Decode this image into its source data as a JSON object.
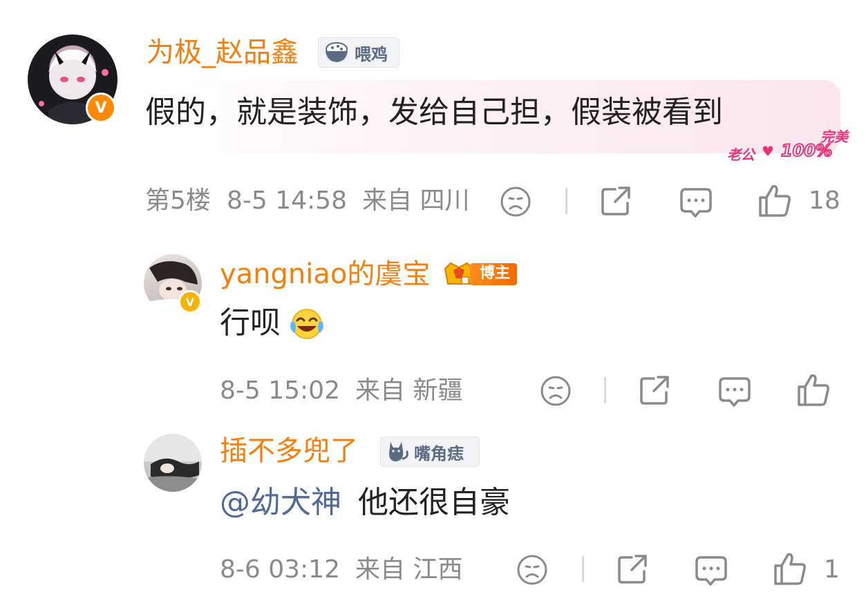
{
  "comments": [
    {
      "username": "为极_赵品鑫",
      "badge": {
        "label": "喂鸡",
        "icon": "rice-bowl-icon"
      },
      "content": "假的，就是装饰，发给自己担，假装被看到",
      "bubble_decoration": {
        "line1": "完美",
        "line2": "老公",
        "line3": "100%"
      },
      "floor": "第5楼",
      "time": "8-5 14:58",
      "location": "来自 四川",
      "likes": "18",
      "verified": "V"
    },
    {
      "username": "yangniao的虞宝",
      "badge": {
        "label": "博主",
        "icon": "crown-icon"
      },
      "content": "行呗",
      "emoji": "laugh-cry-emoji",
      "time": "8-5 15:02",
      "location": "来自 新疆",
      "likes": "",
      "verified": "V"
    },
    {
      "username": "插不多兜了",
      "badge": {
        "label": "嘴角痣",
        "icon": "cat-icon"
      },
      "mention": "@幼犬神",
      "content": "他还很自豪",
      "time": "8-6 03:12",
      "location": "来自 江西",
      "likes": "1"
    }
  ],
  "colors": {
    "username": "#f37f0f",
    "mention": "#506a94",
    "meta": "#8a8a8a",
    "text": "#222222"
  }
}
